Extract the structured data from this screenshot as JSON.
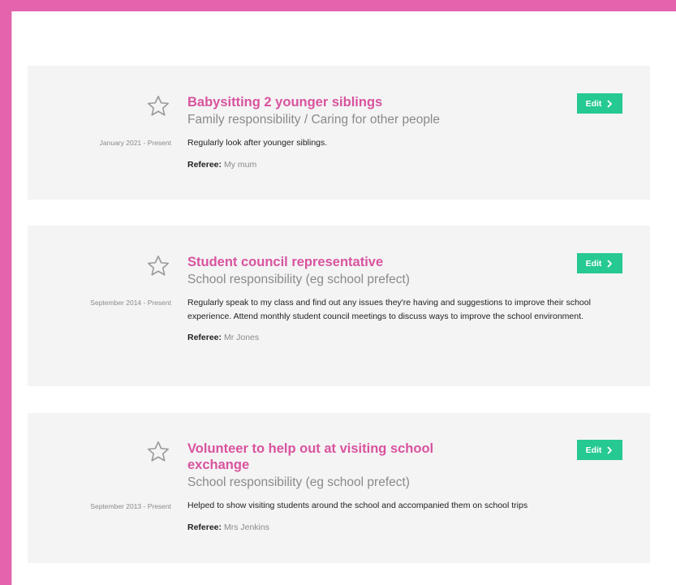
{
  "colors": {
    "frame": "#e363ad",
    "title": "#d9539f",
    "button": "#26c992",
    "card_bg": "#f4f4f4",
    "muted_text": "#8a8a8a"
  },
  "entries": [
    {
      "title": "Babysitting 2 younger siblings",
      "category": "Family responsibility / Caring for other people",
      "date": "January 2021 - Present",
      "description": "Regularly look after younger siblings.",
      "referee_label": "Referee:",
      "referee_name": "My mum",
      "edit_label": "Edit",
      "star_icon": "star-outline-icon",
      "edit_icon": "chevron-right-icon"
    },
    {
      "title": "Student council representative",
      "category": "School responsibility (eg school prefect)",
      "date": "September 2014 - Present",
      "description": "Regularly speak to my class and find out any issues they're having and suggestions to improve their school experience. Attend monthly student council meetings to discuss ways to improve the school environment.",
      "referee_label": "Referee:",
      "referee_name": "Mr Jones",
      "edit_label": "Edit",
      "star_icon": "star-outline-icon",
      "edit_icon": "chevron-right-icon"
    },
    {
      "title": "Volunteer to help out at visiting school exchange",
      "category": "School responsibility (eg school prefect)",
      "date": "September 2013 - Present",
      "description": "Helped to show visiting students around the school and accompanied them on school trips",
      "referee_label": "Referee:",
      "referee_name": "Mrs Jenkins",
      "edit_label": "Edit",
      "star_icon": "star-outline-icon",
      "edit_icon": "chevron-right-icon"
    }
  ]
}
